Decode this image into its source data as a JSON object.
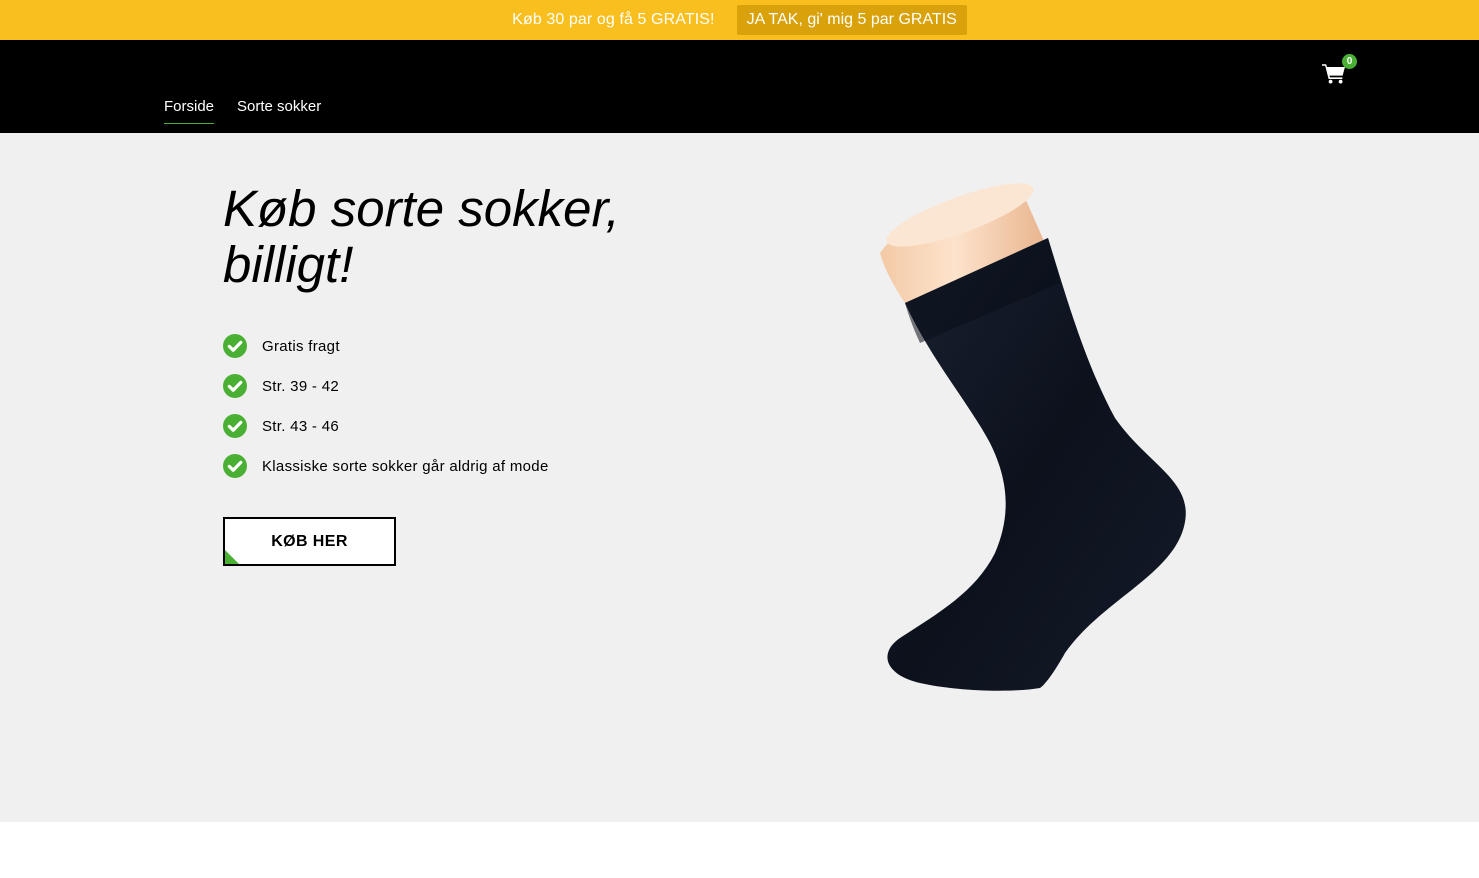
{
  "promo": {
    "text": "Køb 30 par og få 5 GRATIS!",
    "button_label": "JA TAK, gi' mig 5 par GRATIS"
  },
  "header": {
    "cart_count": "0",
    "nav": [
      {
        "label": "Forside",
        "active": true
      },
      {
        "label": "Sorte sokker",
        "active": false
      }
    ]
  },
  "hero": {
    "title": "Køb sorte sokker, billigt!",
    "features": [
      "Gratis fragt",
      "Str. 39 - 42",
      "Str. 43 - 46",
      "Klassiske sorte sokker går aldrig af mode"
    ],
    "buy_button_label": "KØB HER"
  },
  "colors": {
    "promo_bg": "#f9bf1e",
    "promo_button_bg": "#d9a10a",
    "header_bg": "#000000",
    "accent_green": "#4ab034",
    "hero_bg": "#f0f0f0"
  },
  "icons": {
    "cart": "shopping-cart-icon",
    "feature": "check-circle-icon"
  }
}
